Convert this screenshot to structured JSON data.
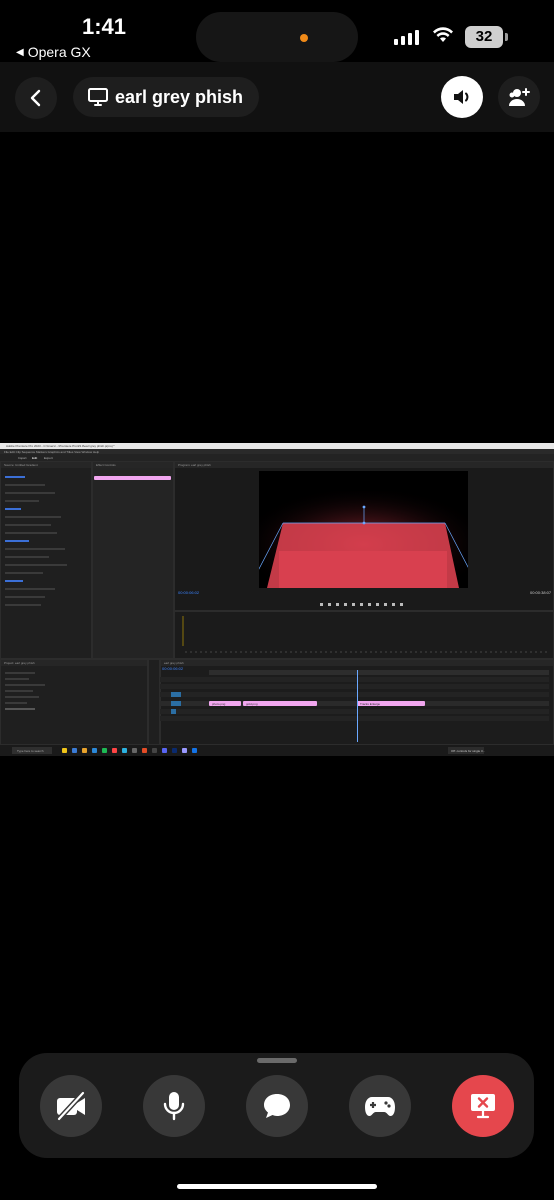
{
  "status_bar": {
    "time": "1:41",
    "back_app": "Opera GX",
    "battery": "32"
  },
  "call": {
    "title": "earl grey phish"
  },
  "shared_screen": {
    "window_title": "Adobe Premiere Pro 2023 - C:\\Users\\...\\Premiere Pro\\23.0\\earl grey phish.prproj *",
    "menu": "File  Edit  Clip  Sequence  Markers  Graphics and Titles  View  Window  Help",
    "workspace_tabs": [
      "Import",
      "Edit",
      "Export"
    ],
    "source_panel": "Source: Untitled Gradient",
    "effect_controls_tab": "Effect Controls",
    "project_panel": "Project: earl grey phish",
    "program_panel": "Program: earl grey phish",
    "timecode_left": "00:00:06:02",
    "timecode_right": "00:00:38:07",
    "timeline_timecode": "00:00:06:02",
    "timeline_tab": "earl grey phish",
    "clips": [
      "photo.png",
      "gold.png",
      "Tracks Enlarge"
    ],
    "taskbar_search": "Type here to search",
    "taskbar_notification": "Off: controls for single 3..."
  },
  "controls": {
    "camera": "camera-off-icon",
    "mic": "microphone-icon",
    "chat": "chat-bubble-icon",
    "activities": "gamepad-icon",
    "stop": "stop-sharing-icon"
  },
  "colors": {
    "stop_button": "#e5474d",
    "clip_pink": "#f1a6ef",
    "program_red": "#d8404f",
    "accent_blue": "#3b83ff"
  }
}
